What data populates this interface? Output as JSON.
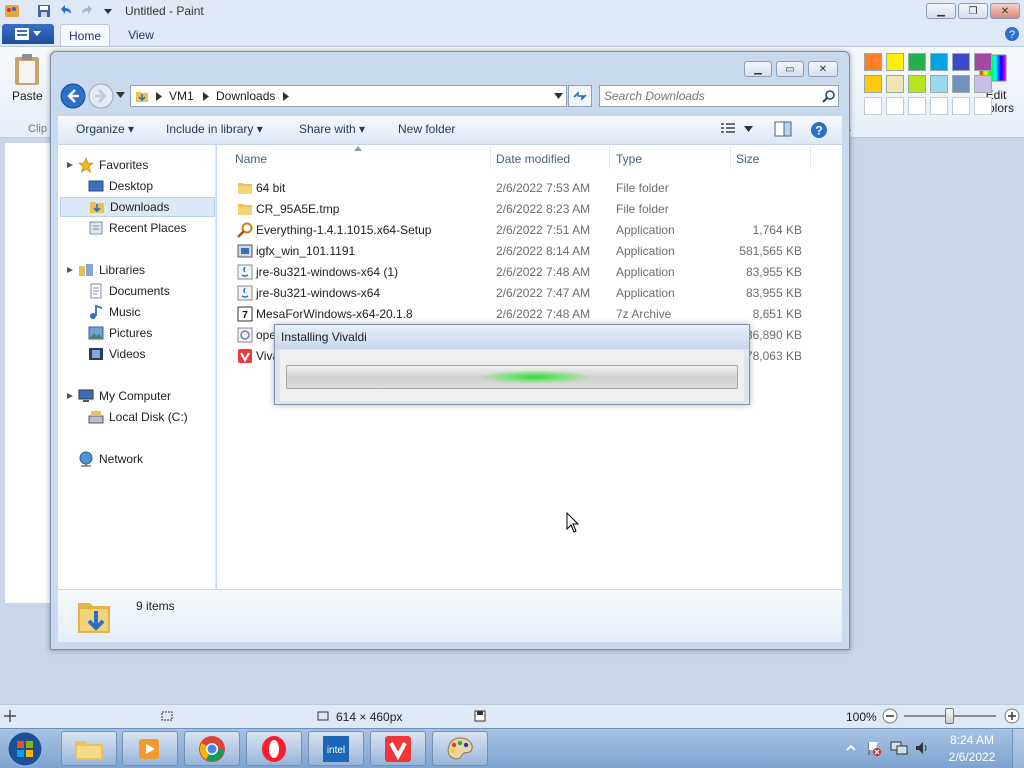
{
  "paint": {
    "title": "Untitled - Paint",
    "tabs": [
      "Home",
      "View"
    ],
    "paste_label": "Paste",
    "clipboard_label": "Clip",
    "edit_colors_label": "Edit colors",
    "colors_group_label": "rs",
    "status": {
      "dimensions": "614 × 460px",
      "zoom": "100%"
    },
    "palette": [
      "#ff7f27",
      "#fff200",
      "#22b14c",
      "#00a2e8",
      "#3f48cc",
      "#a349a4",
      "#ffc90e",
      "#efe4b0",
      "#b5e61d",
      "#99d9ea",
      "#7092be",
      "#c8bfe7",
      "#ffffff",
      "#ffffff",
      "#ffffff",
      "#ffffff",
      "#ffffff",
      "#ffffff"
    ]
  },
  "explorer": {
    "breadcrumb": [
      "VM1",
      "Downloads"
    ],
    "search_placeholder": "Search Downloads",
    "toolbar": {
      "organize": "Organize",
      "include_in_library": "Include in library",
      "share_with": "Share with",
      "new_folder": "New folder"
    },
    "tree": {
      "favorites": "Favorites",
      "desktop": "Desktop",
      "downloads": "Downloads",
      "recent_places": "Recent Places",
      "libraries": "Libraries",
      "documents": "Documents",
      "music": "Music",
      "pictures": "Pictures",
      "videos": "Videos",
      "my_computer": "My Computer",
      "local_disk": "Local Disk (C:)",
      "network": "Network"
    },
    "columns": {
      "name": "Name",
      "date_modified": "Date modified",
      "type": "Type",
      "size": "Size"
    },
    "files": [
      {
        "name": "64 bit",
        "date": "2/6/2022 7:53 AM",
        "type": "File folder",
        "size": "",
        "icon": "folder-icon"
      },
      {
        "name": "CR_95A5E.tmp",
        "date": "2/6/2022 8:23 AM",
        "type": "File folder",
        "size": "",
        "icon": "folder-icon"
      },
      {
        "name": "Everything-1.4.1.1015.x64-Setup",
        "date": "2/6/2022 7:51 AM",
        "type": "Application",
        "size": "1,764 KB",
        "icon": "magnifier-app-icon"
      },
      {
        "name": "igfx_win_101.1191",
        "date": "2/6/2022 8:14 AM",
        "type": "Application",
        "size": "581,565 KB",
        "icon": "installer-app-icon"
      },
      {
        "name": "jre-8u321-windows-x64 (1)",
        "date": "2/6/2022 7:48 AM",
        "type": "Application",
        "size": "83,955 KB",
        "icon": "java-app-icon"
      },
      {
        "name": "jre-8u321-windows-x64",
        "date": "2/6/2022 7:47 AM",
        "type": "Application",
        "size": "83,955 KB",
        "icon": "java-app-icon"
      },
      {
        "name": "MesaForWindows-x64-20.1.8",
        "date": "2/6/2022 7:48 AM",
        "type": "7z Archive",
        "size": "8,651 KB",
        "icon": "archive-icon"
      },
      {
        "name": "ope",
        "date": "",
        "type": "",
        "size": "36,890 KB",
        "icon": "opera-setup-icon"
      },
      {
        "name": "Viva",
        "date": "",
        "type": "",
        "size": "78,063 KB",
        "icon": "vivaldi-setup-icon"
      }
    ],
    "item_count": "9 items"
  },
  "installer": {
    "title": "Installing Vivaldi",
    "progress": 0.55
  },
  "taskbar": {
    "time": "8:24 AM",
    "date": "2/6/2022"
  }
}
